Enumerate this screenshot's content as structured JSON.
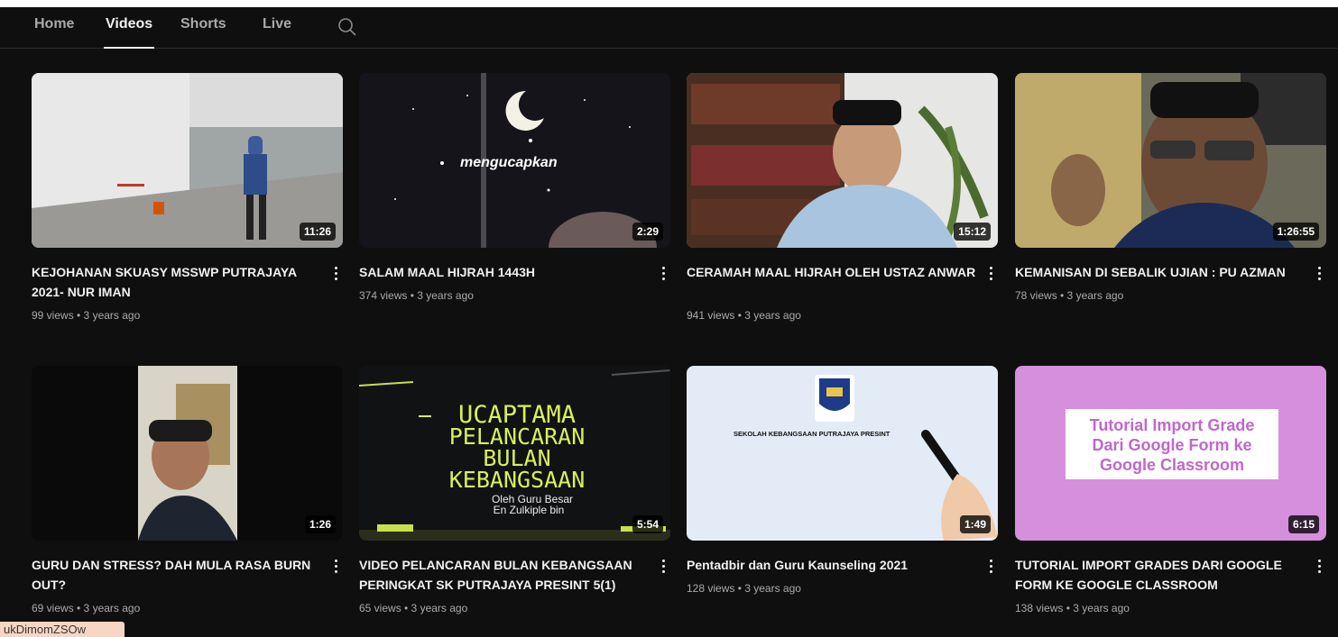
{
  "tabs": [
    {
      "label": "Home",
      "active": false
    },
    {
      "label": "Videos",
      "active": true
    },
    {
      "label": "Shorts",
      "active": false
    },
    {
      "label": "Live",
      "active": false
    }
  ],
  "videos": [
    {
      "title": "KEJOHANAN SKUASY MSSWP PUTRAJAYA 2021- NUR IMAN",
      "meta": "99 views • 3 years ago",
      "duration": "11:26"
    },
    {
      "title": "SALAM MAAL HIJRAH 1443H",
      "meta": "374 views • 3 years ago",
      "duration": "2:29",
      "thumb_text": "mengucapkan"
    },
    {
      "title": "CERAMAH MAAL HIJRAH OLEH USTAZ ANWAR",
      "meta": "941 views • 3 years ago",
      "duration": "15:12"
    },
    {
      "title": "KEMANISAN DI SEBALIK UJIAN : PU AZMAN",
      "meta": "78 views • 3 years ago",
      "duration": "1:26:55"
    },
    {
      "title": "GURU DAN STRESS? DAH MULA RASA BURN OUT?",
      "meta": "69 views • 3 years ago",
      "duration": "1:26"
    },
    {
      "title": "VIDEO PELANCARAN BULAN KEBANGSAAN PERINGKAT SK PUTRAJAYA PRESINT 5(1)",
      "meta": "65 views • 3 years ago",
      "duration": "5:54",
      "thumb_lines": [
        "UCAPTAMA",
        "PELANCARAN",
        "BULAN",
        "KEBANGSAAN"
      ],
      "thumb_sub1": "Oleh Guru Besar",
      "thumb_sub2": "En Zulkiple bin"
    },
    {
      "title": "Pentadbir dan Guru Kaunseling 2021",
      "meta": "128 views • 3 years ago",
      "duration": "1:49",
      "thumb_text": "SEKOLAH KEBANGSAAN PUTRAJAYA PRESINT"
    },
    {
      "title": "TUTORIAL IMPORT GRADES DARI GOOGLE FORM KE GOOGLE CLASSROOM",
      "meta": "138 views • 3 years ago",
      "duration": "6:15",
      "thumb_lines": [
        "Tutorial Import Grade",
        "Dari Google Form ke",
        "Google Classroom"
      ]
    }
  ],
  "tooltip": "ukDimomZSOw",
  "colors": {
    "background": "#0f0f0f",
    "text": "#f1f1f1",
    "muted": "#aaaaaa",
    "tutorial_bg": "#d58fdc",
    "tutorial_text": "#c166cc"
  }
}
